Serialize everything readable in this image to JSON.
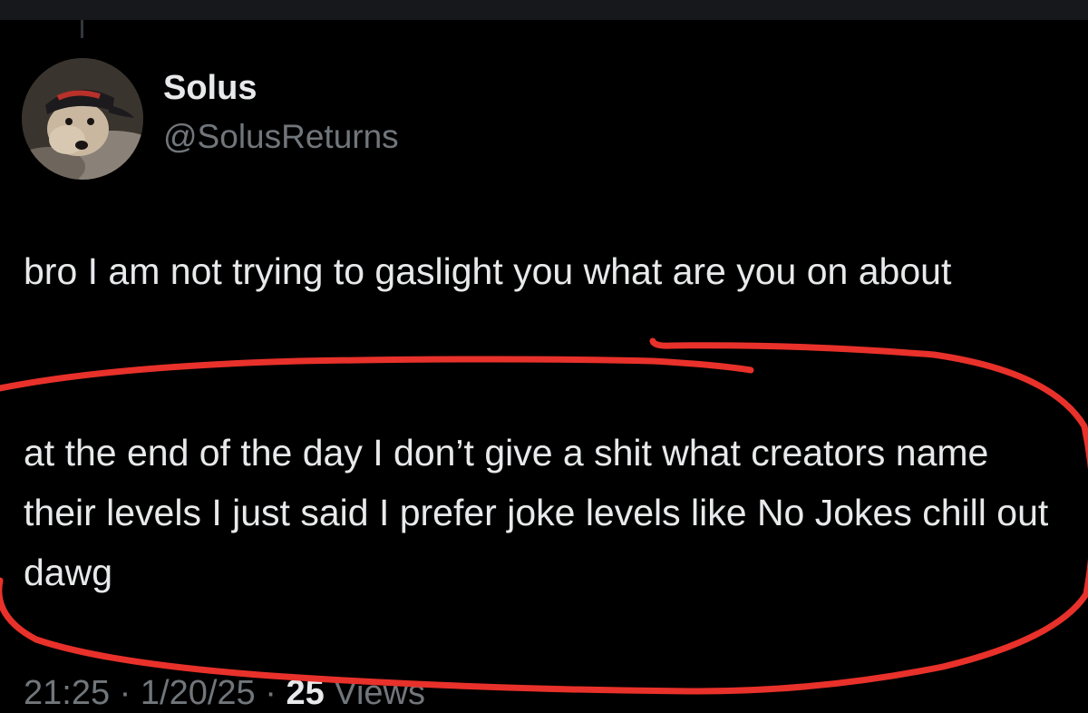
{
  "tweet": {
    "display_name": "Solus",
    "handle": "@SolusReturns",
    "paragraph_1": "bro I am not trying to gaslight you what are you on about",
    "paragraph_2": "at the end of the day I don’t give a shit what creators name their levels I just said I prefer joke levels like No Jokes chill out dawg",
    "time": "21:25",
    "date": "1/20/25",
    "separator": "·",
    "views_count": "25",
    "views_label": "Views"
  },
  "avatar": {
    "description_icon": "dog-in-cap-avatar"
  },
  "annotation": {
    "color": "#e8312a",
    "shape": "hand-drawn-ellipse"
  },
  "colors": {
    "background": "#000000",
    "primary_text": "#e7e9ea",
    "secondary_text": "#71767b"
  }
}
